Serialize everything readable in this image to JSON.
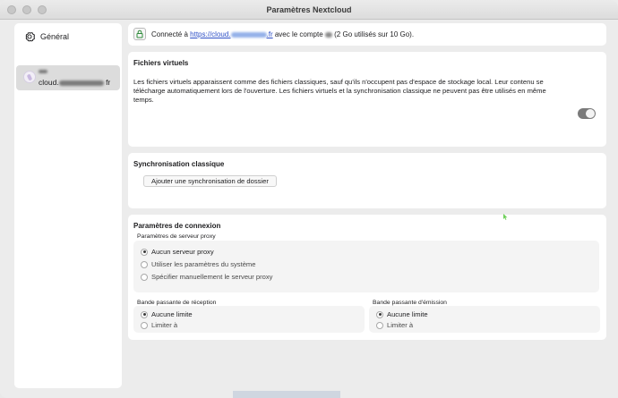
{
  "window": {
    "title": "Paramètres Nextcloud"
  },
  "sidebar": {
    "general_label": "Général",
    "account": {
      "host_prefix": "cloud.",
      "host_suffix": "fr"
    }
  },
  "connection": {
    "prefix": "Connecté à",
    "link_prefix": "https://cloud.",
    "link_suffix": ".fr",
    "account_text": "avec le compte",
    "usage": "(2 Go utilisés sur 10 Go)."
  },
  "virtual_files": {
    "title": "Fichiers virtuels",
    "description": "Les fichiers virtuels apparaissent comme des fichiers classiques, sauf qu'ils n'occupent pas d'espace de stockage local. Leur contenu se télécharge automatiquement lors de l'ouverture. Les fichiers virtuels et la synchronisation classique ne peuvent pas être utilisés en même temps.",
    "toggle_on": true
  },
  "classic_sync": {
    "title": "Synchronisation classique",
    "add_button": "Ajouter une synchronisation de dossier"
  },
  "network": {
    "title": "Paramètres de connexion",
    "proxy_label": "Paramètres de serveur proxy",
    "proxy_options": [
      "Aucun serveur proxy",
      "Utiliser les paramètres du système",
      "Spécifier manuellement le serveur proxy"
    ],
    "download_label": "Bande passante de réception",
    "upload_label": "Bande passante d'émission",
    "no_limit": "Aucune limite",
    "limit_to": "Limiter à"
  }
}
